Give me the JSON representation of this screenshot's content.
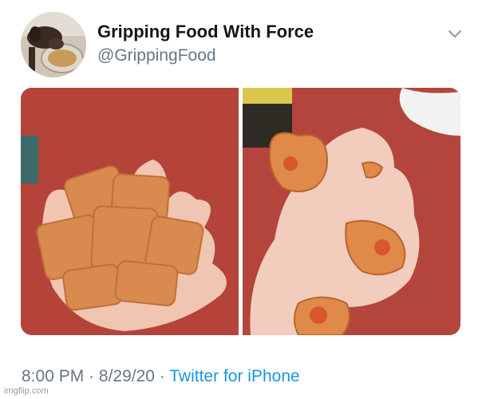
{
  "tweet": {
    "author_name": "Gripping Food With Force",
    "author_handle": "@GrippingFood",
    "avatar_icon": "dog-with-food-bowl-avatar",
    "menu_icon": "chevron-down-icon",
    "photos": [
      {
        "content": "hand-holding-pizza-rolls-photo"
      },
      {
        "content": "fist-crushing-pizza-rolls-photo"
      }
    ],
    "time": "8:00 PM",
    "separator": " · ",
    "date": "8/29/20",
    "source": "Twitter for iPhone"
  },
  "watermark": "imgflip.com",
  "colors": {
    "name": "#14171a",
    "secondary": "#657786",
    "link": "#1b95e0"
  }
}
